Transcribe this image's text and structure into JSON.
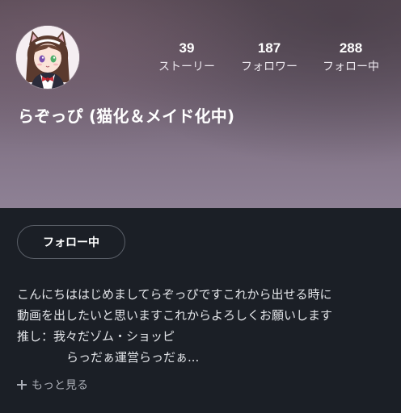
{
  "profile": {
    "display_name": "らぞっぴ (猫化＆メイド化中)",
    "avatar_icon": "avatar-anime-maid-cat-girl"
  },
  "stats": {
    "stories": {
      "value": "39",
      "label": "ストーリー"
    },
    "followers": {
      "value": "187",
      "label": "フォロワー"
    },
    "following": {
      "value": "288",
      "label": "フォロー中"
    }
  },
  "actions": {
    "follow_label": "フォロー中"
  },
  "bio": {
    "lines": [
      "こんにちははじめましてらぞっぴですこれから出せる時に",
      "動画を出したいと思いますこれからよろしくお願いします",
      "推し：我々だゾム・ショッピ",
      "らっだぁ運営らっだぁ..."
    ],
    "show_more_label": "もっと見る"
  },
  "colors": {
    "background": "#1b1f26",
    "header_top": "#5a4c57",
    "header_bottom": "#8e8195",
    "text_primary": "#ffffff",
    "text_secondary": "#a9adb5"
  }
}
